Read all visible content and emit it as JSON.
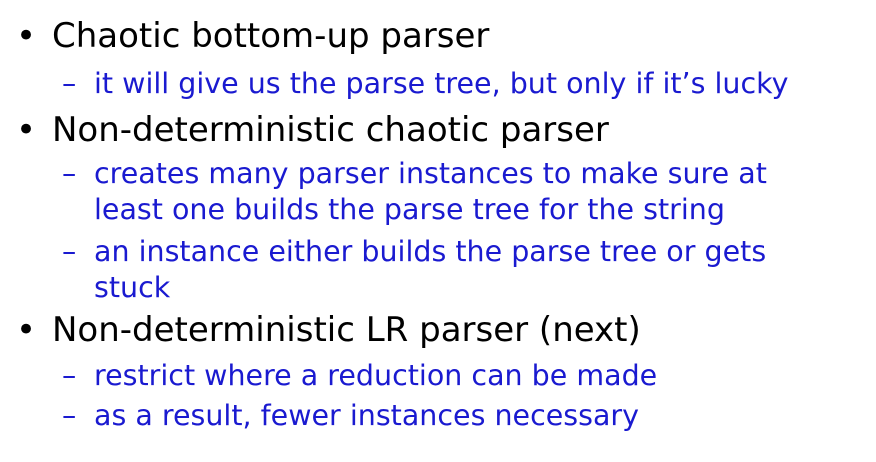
{
  "bullets": [
    {
      "marker": "•",
      "text": "Chaotic bottom-up parser",
      "subs": [
        {
          "marker": "–",
          "text": "it will give us the parse tree, but only if it’s lucky"
        }
      ]
    },
    {
      "marker": "•",
      "text": "Non-deterministic chaotic parser",
      "subs": [
        {
          "marker": "–",
          "text": "creates many parser instances to make sure at least one builds the parse tree for the string"
        },
        {
          "marker": "–",
          "text": "an instance either builds the parse tree or gets stuck"
        }
      ]
    },
    {
      "marker": "•",
      "text": "Non-deterministic LR parser (next)",
      "subs": [
        {
          "marker": "–",
          "text": "restrict where a reduction can be made"
        },
        {
          "marker": "–",
          "text": "as a result, fewer instances necessary"
        }
      ]
    }
  ],
  "colors": {
    "main_text": "#000000",
    "sub_text": "#1a1ad0",
    "background": "#ffffff"
  }
}
